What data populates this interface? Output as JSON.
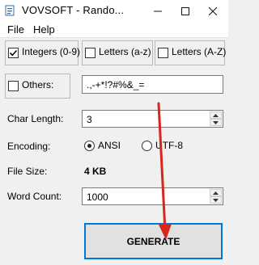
{
  "window": {
    "title": "VOVSOFT - Rando...",
    "buttons": [
      "minimize",
      "maximize",
      "close"
    ]
  },
  "menu": {
    "file": "File",
    "help": "Help"
  },
  "options": {
    "integers": {
      "label": "Integers (0-9)",
      "checked": true
    },
    "lowercase": {
      "label": "Letters (a-z)",
      "checked": false
    },
    "uppercase": {
      "label": "Letters (A-Z)",
      "checked": false
    },
    "others": {
      "label": "Others:",
      "checked": false,
      "value": ".,-+*!?#%&_="
    }
  },
  "char_length": {
    "label": "Char Length:",
    "value": "3"
  },
  "encoding": {
    "label": "Encoding:",
    "options": [
      "ANSI",
      "UTF-8"
    ],
    "selected": "ANSI"
  },
  "file_size": {
    "label": "File Size:",
    "value": "4 KB"
  },
  "word_count": {
    "label": "Word Count:",
    "value": "1000"
  },
  "generate_label": "GENERATE",
  "colors": {
    "focus_border": "#0078d7",
    "annotation_arrow": "#d9261c"
  }
}
